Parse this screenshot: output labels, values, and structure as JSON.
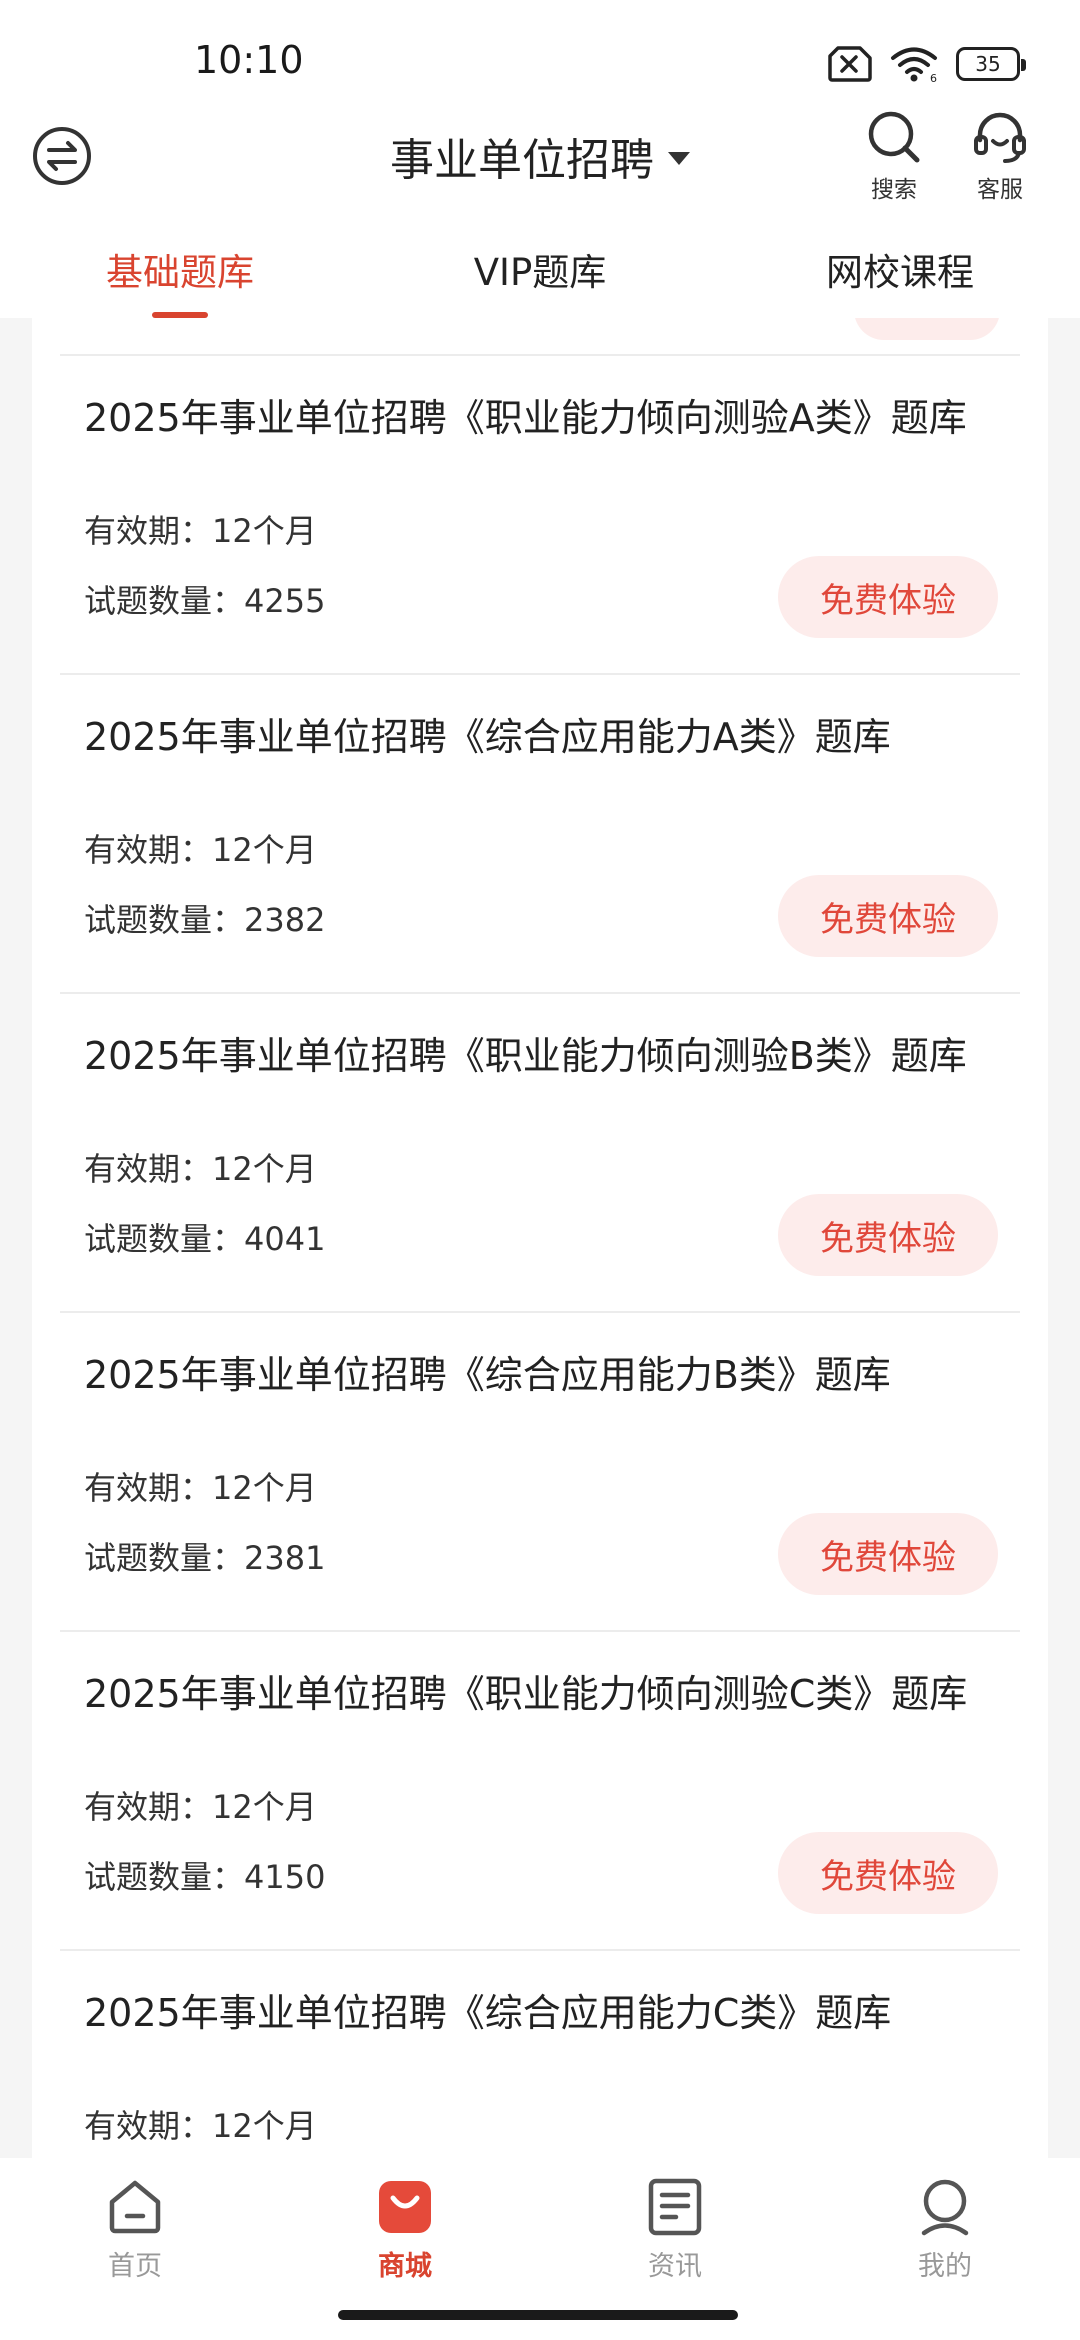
{
  "status_bar": {
    "time": "10:10",
    "battery": "35"
  },
  "header": {
    "title": "事业单位招聘",
    "search_label": "搜索",
    "service_label": "客服"
  },
  "tabs": [
    {
      "label": "基础题库",
      "active": true
    },
    {
      "label": "VIP题库",
      "active": false
    },
    {
      "label": "网校课程",
      "active": false
    }
  ],
  "items": [
    {
      "title": "2025年事业单位招聘《职业能力倾向测验A类》题库",
      "valid": "有效期：12个月",
      "count": "试题数量：4255",
      "button": "免费体验"
    },
    {
      "title": "2025年事业单位招聘《综合应用能力A类》题库",
      "valid": "有效期：12个月",
      "count": "试题数量：2382",
      "button": "免费体验"
    },
    {
      "title": "2025年事业单位招聘《职业能力倾向测验B类》题库",
      "valid": "有效期：12个月",
      "count": "试题数量：4041",
      "button": "免费体验"
    },
    {
      "title": "2025年事业单位招聘《综合应用能力B类》题库",
      "valid": "有效期：12个月",
      "count": "试题数量：2381",
      "button": "免费体验"
    },
    {
      "title": "2025年事业单位招聘《职业能力倾向测验C类》题库",
      "valid": "有效期：12个月",
      "count": "试题数量：4150",
      "button": "免费体验"
    },
    {
      "title": "2025年事业单位招聘《综合应用能力C类》题库",
      "valid": "有效期：12个月",
      "count": "",
      "button": ""
    }
  ],
  "bottom_nav": [
    {
      "label": "首页",
      "icon": "home-icon",
      "active": false
    },
    {
      "label": "商城",
      "icon": "shop-bag-icon",
      "active": true
    },
    {
      "label": "资讯",
      "icon": "news-icon",
      "active": false
    },
    {
      "label": "我的",
      "icon": "profile-icon",
      "active": false
    }
  ],
  "colors": {
    "accent": "#d9442f",
    "button_bg": "#fdeceb",
    "button_text": "#e0473a"
  }
}
